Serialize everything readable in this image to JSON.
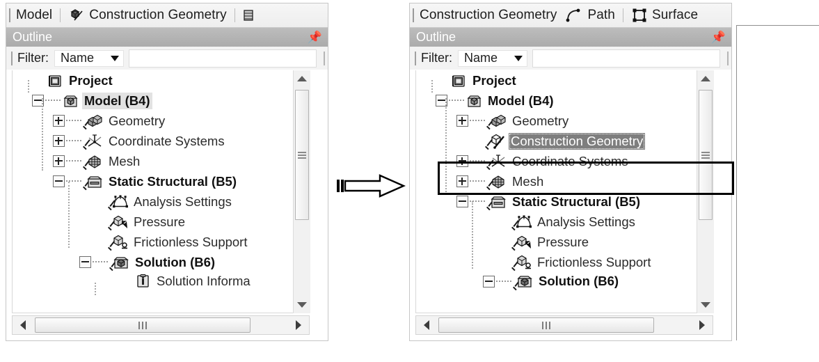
{
  "left_panel": {
    "toolbar": {
      "items": [
        {
          "label": "Model",
          "icon": "none"
        },
        {
          "label": "Construction Geometry",
          "icon": "construction-geometry-icon"
        },
        {
          "label": "",
          "icon": "partial-icon"
        }
      ]
    },
    "outline": {
      "title": "Outline",
      "pin_icon": "pin-icon"
    },
    "filter": {
      "label": "Filter:",
      "mode": "Name",
      "value": "",
      "placeholder": ""
    },
    "tree": [
      {
        "label": "Project",
        "depth": 0,
        "toggle": "none",
        "check": false,
        "icon": "project-icon",
        "bold": true,
        "state": "normal"
      },
      {
        "label": "Model (B4)",
        "depth": 1,
        "toggle": "minus",
        "check": false,
        "icon": "model-icon",
        "bold": true,
        "state": "soft-selected"
      },
      {
        "label": "Geometry",
        "depth": 2,
        "toggle": "plus",
        "check": true,
        "icon": "geometry-icon",
        "bold": false,
        "state": "normal"
      },
      {
        "label": "Coordinate Systems",
        "depth": 2,
        "toggle": "plus",
        "check": true,
        "icon": "coordinate-systems-icon",
        "bold": false,
        "state": "normal"
      },
      {
        "label": "Mesh",
        "depth": 2,
        "toggle": "plus",
        "check": true,
        "icon": "mesh-icon",
        "bold": false,
        "state": "normal"
      },
      {
        "label": "Static Structural (B5)",
        "depth": 2,
        "toggle": "minus",
        "check": true,
        "icon": "environment-icon",
        "bold": true,
        "state": "normal"
      },
      {
        "label": "Analysis Settings",
        "depth": 3,
        "toggle": "none",
        "check": true,
        "icon": "analysis-settings-icon",
        "bold": false,
        "state": "normal"
      },
      {
        "label": "Pressure",
        "depth": 3,
        "toggle": "none",
        "check": true,
        "icon": "pressure-icon",
        "bold": false,
        "state": "normal"
      },
      {
        "label": "Frictionless Support",
        "depth": 3,
        "toggle": "none",
        "check": true,
        "icon": "frictionless-support-icon",
        "bold": false,
        "state": "normal"
      },
      {
        "label": "Solution (B6)",
        "depth": 3,
        "toggle": "minus",
        "check": true,
        "icon": "solution-icon",
        "bold": true,
        "state": "normal"
      },
      {
        "label": "Solution Informa",
        "depth": 4,
        "toggle": "none",
        "check": false,
        "icon": "solution-information-icon",
        "bold": false,
        "state": "clipped"
      }
    ],
    "scroll": {
      "vertical_up_icon": "scroll-up-arrow-icon",
      "vertical_down_icon": "scroll-down-arrow-icon",
      "horizontal_left_icon": "scroll-left-arrow-icon",
      "horizontal_right_icon": "scroll-right-arrow-icon"
    }
  },
  "transition": {
    "arrow_icon": "right-block-arrow-icon"
  },
  "right_panel": {
    "toolbar": {
      "items": [
        {
          "label": "Construction Geometry",
          "icon": "none"
        },
        {
          "label": "Path",
          "icon": "path-icon"
        },
        {
          "label": "Surface",
          "icon": "surface-icon"
        }
      ]
    },
    "outline": {
      "title": "Outline",
      "pin_icon": "pin-icon"
    },
    "filter": {
      "label": "Filter:",
      "mode": "Name",
      "value": "",
      "placeholder": ""
    },
    "tree": [
      {
        "label": "Project",
        "depth": 0,
        "toggle": "none",
        "check": false,
        "icon": "project-icon",
        "bold": true,
        "state": "normal"
      },
      {
        "label": "Model (B4)",
        "depth": 1,
        "toggle": "minus",
        "check": false,
        "icon": "model-icon",
        "bold": true,
        "state": "normal"
      },
      {
        "label": "Geometry",
        "depth": 2,
        "toggle": "plus",
        "check": true,
        "icon": "geometry-icon",
        "bold": false,
        "state": "normal"
      },
      {
        "label": "Construction Geometry",
        "depth": 2,
        "toggle": "none",
        "check": true,
        "icon": "construction-geometry-icon",
        "bold": false,
        "state": "selected"
      },
      {
        "label": "Coordinate Systems",
        "depth": 2,
        "toggle": "plus",
        "check": true,
        "icon": "coordinate-systems-icon",
        "bold": false,
        "state": "normal"
      },
      {
        "label": "Mesh",
        "depth": 2,
        "toggle": "plus",
        "check": true,
        "icon": "mesh-icon",
        "bold": false,
        "state": "normal"
      },
      {
        "label": "Static Structural (B5)",
        "depth": 2,
        "toggle": "minus",
        "check": true,
        "icon": "environment-icon",
        "bold": true,
        "state": "normal"
      },
      {
        "label": "Analysis Settings",
        "depth": 3,
        "toggle": "none",
        "check": true,
        "icon": "analysis-settings-icon",
        "bold": false,
        "state": "normal"
      },
      {
        "label": "Pressure",
        "depth": 3,
        "toggle": "none",
        "check": true,
        "icon": "pressure-icon",
        "bold": false,
        "state": "normal"
      },
      {
        "label": "Frictionless Support",
        "depth": 3,
        "toggle": "none",
        "check": true,
        "icon": "frictionless-support-icon",
        "bold": false,
        "state": "normal"
      },
      {
        "label": "Solution (B6)",
        "depth": 3,
        "toggle": "minus",
        "check": true,
        "icon": "solution-icon",
        "bold": true,
        "state": "clipped"
      }
    ],
    "highlight": {
      "target": "Construction Geometry",
      "color": "#000000"
    },
    "scroll": {
      "vertical_up_icon": "scroll-up-arrow-icon",
      "vertical_down_icon": "scroll-down-arrow-icon",
      "horizontal_left_icon": "scroll-left-arrow-icon",
      "horizontal_right_icon": "scroll-right-arrow-icon"
    }
  },
  "colors": {
    "selection": "#7e7e7e",
    "soft_selection": "#e2e2e2",
    "outline_bar": "#b0b0b0",
    "annotation": "#000000",
    "toolbar_bg": "#f2f2f2"
  }
}
